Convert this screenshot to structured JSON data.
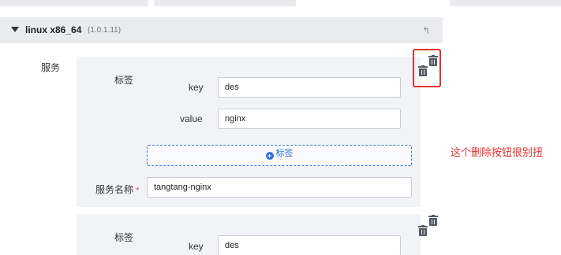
{
  "header": {
    "title": "linux x86_64",
    "version": "(1.0.1.11)",
    "reply_icon": "reply-icon"
  },
  "service_section": {
    "label": "服务"
  },
  "service1": {
    "tag_label": "标签",
    "key_label": "key",
    "key_value": "des",
    "value_label": "value",
    "value_value": "nginx",
    "add_tag_label": "标签",
    "service_name_label": "服务名称",
    "required_mark": "*",
    "service_name_value": "tangtang-nginx"
  },
  "service2": {
    "tag_label": "标签",
    "key_label": "key",
    "key_value": "des"
  },
  "annotation": {
    "text": "这个删除按钮很别扭",
    "color": "#e23131"
  },
  "icons": [
    "caret-down-icon",
    "reply-icon",
    "trash-icon",
    "plus-circle-icon"
  ]
}
